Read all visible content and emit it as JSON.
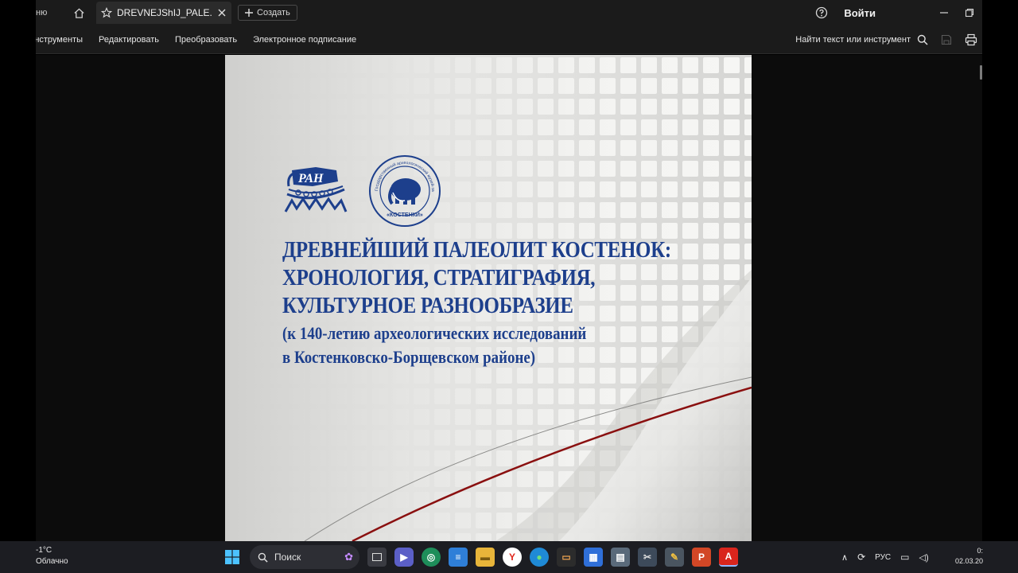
{
  "tabbar": {
    "home_tab_text": "ню",
    "doc_tab_title": "DREVNEJShIJ_PALE...",
    "new_label": "Создать",
    "signin_label": "Войти"
  },
  "toolbar": {
    "tools_label": "нструменты",
    "edit_label": "Редактировать",
    "convert_label": "Преобразовать",
    "esign_label": "Электронное подписание",
    "find_label": "Найти текст или инструмент"
  },
  "document": {
    "logo_left_text": "РАН",
    "logo_right_ring_text": "Государственный археологический музей-заповедник",
    "logo_right_bottom_text": "«КОСТЕНКИ»",
    "title_lines": [
      "ДРЕВНЕЙШИЙ ПАЛЕОЛИТ КОСТЕНОК:",
      "ХРОНОЛОГИЯ, СТРАТИГРАФИЯ,",
      "КУЛЬТУРНОЕ РАЗНООБРАЗИЕ"
    ],
    "subtitle_lines": [
      "(к 140-летию археологических исследований",
      "в Костенковско-Борщевском районе)"
    ]
  },
  "taskbar": {
    "weather_temp": "-1°C",
    "weather_desc": "Облачно",
    "search_label": "Поиск",
    "lang": "РУС",
    "time": "0:",
    "date": "02.03.20"
  },
  "colors": {
    "cover_blue": "#1d3f8c",
    "accent_red": "#8a1010",
    "pdf_red": "#d9251d"
  }
}
